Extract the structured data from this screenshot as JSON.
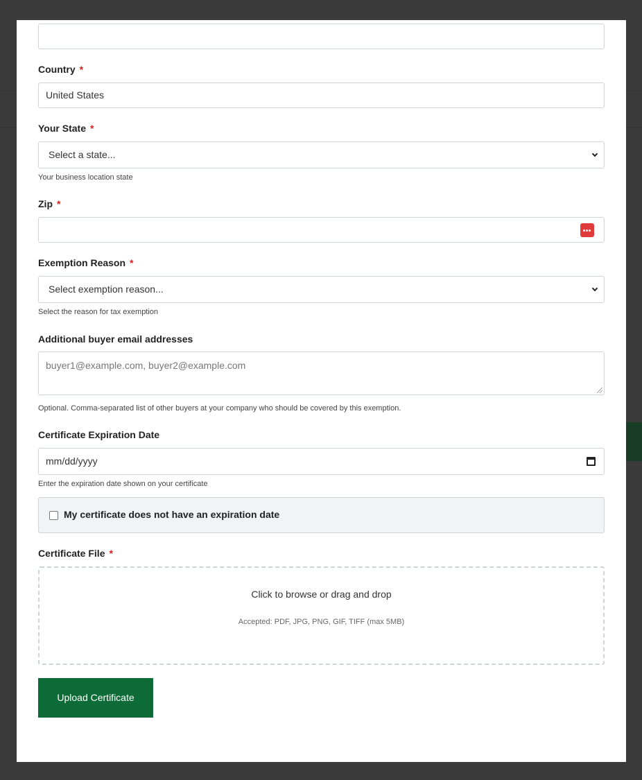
{
  "form": {
    "top_input": {
      "value": ""
    },
    "country": {
      "label": "Country",
      "required_mark": "*",
      "value": "United States"
    },
    "state": {
      "label": "Your State",
      "required_mark": "*",
      "selected": "Select a state...",
      "help": "Your business location state"
    },
    "zip": {
      "label": "Zip",
      "required_mark": "*",
      "value": ""
    },
    "exemption_reason": {
      "label": "Exemption Reason",
      "required_mark": "*",
      "selected": "Select exemption reason...",
      "help": "Select the reason for tax exemption"
    },
    "additional_emails": {
      "label": "Additional buyer email addresses",
      "placeholder": "buyer1@example.com, buyer2@example.com",
      "help": "Optional. Comma-separated list of other buyers at your company who should be covered by this exemption."
    },
    "expiration_date": {
      "label": "Certificate Expiration Date",
      "placeholder": "mm/dd/yyyy",
      "help": "Enter the expiration date shown on your certificate"
    },
    "no_expiration": {
      "label": "My certificate does not have an expiration date",
      "checked": false
    },
    "certificate_file": {
      "label": "Certificate File",
      "required_mark": "*",
      "dropzone_text": "Click to browse or drag and drop",
      "accepted_text": "Accepted: PDF, JPG, PNG, GIF, TIFF (max 5MB)"
    },
    "submit_label": "Upload Certificate"
  },
  "colors": {
    "accent": "#0c6b36",
    "required": "#d9211f",
    "overlay": "#3a3a3a"
  },
  "icons": [
    "password-manager-icon",
    "chevron-down-icon",
    "calendar-icon",
    "checkbox-icon"
  ]
}
